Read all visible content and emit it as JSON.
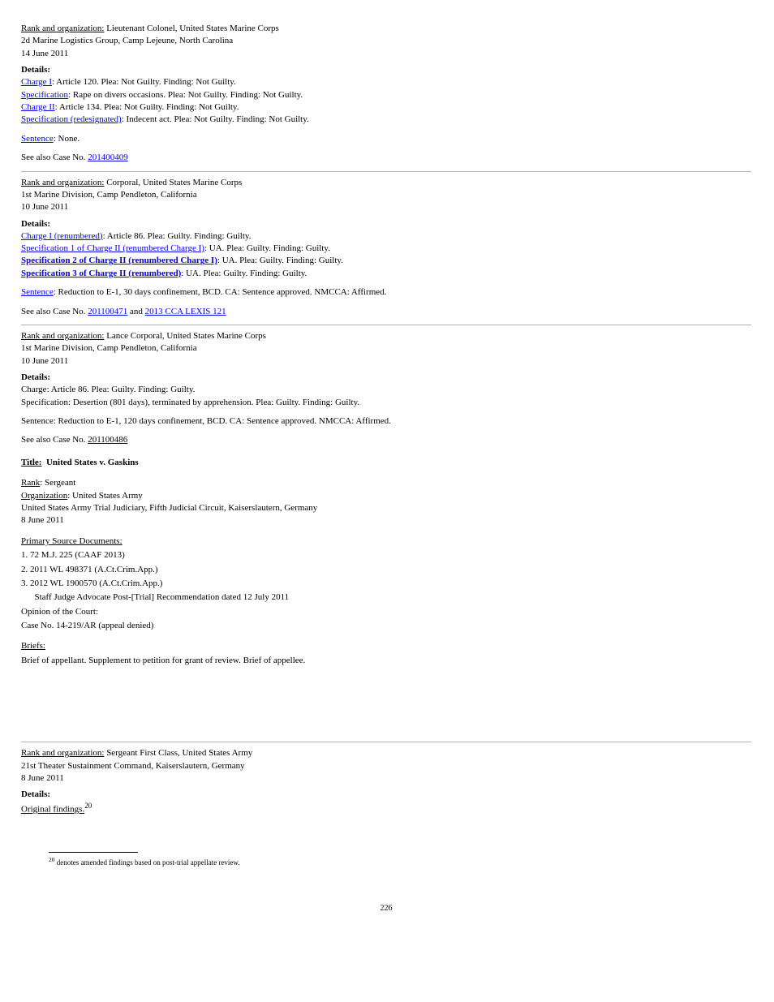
{
  "section1": {
    "header": "Rank and organization:",
    "rank": "Lieutenant Colonel, United States Marine Corps",
    "unit": "2d Marine Logistics Group, Camp Lejeune, North Carolina",
    "date": "14 June 2011",
    "links": [
      {
        "label": "Charge I",
        "suffix": ":   Article 120.  Plea:  Not Guilty.  Finding:  Not Guilty."
      },
      {
        "label": "Specification",
        "suffix": ":  Rape on divers occasions.  Plea:  Not Guilty.  Finding:  Not Guilty."
      },
      {
        "label": "Charge II",
        "suffix": ":  Article 134.  Plea:  Not Guilty.  Finding:  Not Guilty."
      },
      {
        "label": "Specification (redesignated)",
        "suffix": ":  Indecent act.  Plea:  Not Guilty.  Finding:  Not Guilty."
      },
      {
        "label": "Sentence",
        "suffix": ":  None."
      }
    ],
    "seealso_label": "See also Case No.",
    "seealso_link": "201400409"
  },
  "section2": {
    "header": "Rank and organization:",
    "rank": "Corporal, United States Marine Corps",
    "unit": "1st Marine Division, Camp Pendleton, California",
    "date": "10 June 2011",
    "links": [
      {
        "label": "Charge I (renumbered)",
        "suffix": ":  Article 86.  Plea:  Guilty.  Finding:  Guilty.",
        "strong": false
      },
      {
        "label": "Specification 1 of Charge II (renumbered Charge I)",
        "suffix": ":  UA.  Plea:  Guilty.  Finding:  Guilty.",
        "strong": false
      },
      {
        "label": "Specification 2 of Charge II (renumbered Charge I)",
        "suffix": ":  UA.  Plea:  Guilty.  Finding:  Guilty.",
        "strong": true
      },
      {
        "label": "Specification 3 of Charge II (renumbered)",
        "suffix": ":  UA.  Plea:  Guilty.  Finding:  Guilty.",
        "strong": true
      },
      {
        "label": "Sentence",
        "suffix": ":  Reduction to E-1, 30 days confinement, BCD.  CA:  Sentence approved.  NMCCA:  Affirmed.",
        "strong": false
      }
    ],
    "seealso_label": "See also Case No.",
    "seealso_link": "201100471",
    "seealso_extra_label": " and ",
    "seealso_extra_link": "2013 CCA LEXIS 121"
  },
  "section3": {
    "header": "Rank and organization:",
    "rank": "Lance Corporal, United States Marine Corps",
    "unit": "1st Marine Division, Camp Pendleton, California",
    "date": "10 June 2011",
    "details": [
      "Charge:  Article 86.  Plea:  Guilty.  Finding:  Guilty.",
      "Specification:  Desertion (801 days), terminated by apprehension.  Plea:  Guilty.  Finding:  Guilty.",
      "Sentence:  Reduction to E-1, 120 days confinement, BCD.  CA:  Sentence approved.  NMCCA:  Affirmed."
    ],
    "seealso_label": "See also Case No.",
    "seealso_value": "201100486"
  },
  "entry": {
    "title_line": "Title:",
    "title_value": "United States v. Gaskins",
    "rank_label": "Rank",
    "rank_value": ":   Sergeant",
    "org_label": "Organization",
    "org_value": ":  United States Army",
    "location": "United States Army Trial Judiciary, Fifth Judicial Circuit, Kaiserslautern, Germany",
    "date": "8 June 2011",
    "sourcehead": "Primary Source Documents:",
    "sources": [
      "1.  72 M.J. 225 (CAAF 2013)",
      "2.  2011 WL 498371 (A.Ct.Crim.App.)",
      "3.  2012 WL 1900570 (A.Ct.Crim.App.)",
      "      Staff Judge Advocate Post-[Trial] Recommendation dated 12 July 2011",
      "Opinion of the Court:",
      "Case No. 14-219/AR (appeal denied)"
    ],
    "briefs_head": "Brief of appellant. ",
    "briefs_link1": "Supplement to petition for grant of review.",
    "briefs_sep1": "  ",
    "briefs_link2": "Brief of appellee."
  },
  "footnote": {
    "sup": "20",
    "text": "  denotes amended findings based on post-trial appellate review."
  },
  "page_number": "226"
}
